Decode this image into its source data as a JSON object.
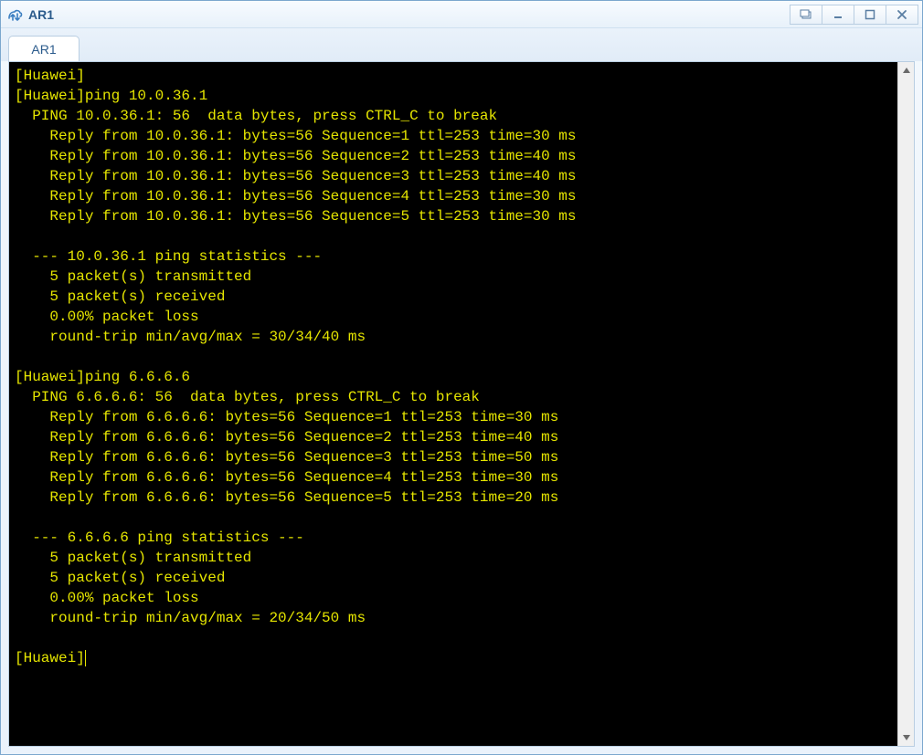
{
  "window": {
    "title": "AR1"
  },
  "tabs": [
    {
      "label": "AR1",
      "active": true
    }
  ],
  "terminal": {
    "prompt_start": "[Huawei]",
    "ping1": {
      "cmd": "[Huawei]ping 10.0.36.1",
      "header": "  PING 10.0.36.1: 56  data bytes, press CTRL_C to break",
      "replies": [
        "    Reply from 10.0.36.1: bytes=56 Sequence=1 ttl=253 time=30 ms",
        "    Reply from 10.0.36.1: bytes=56 Sequence=2 ttl=253 time=40 ms",
        "    Reply from 10.0.36.1: bytes=56 Sequence=3 ttl=253 time=40 ms",
        "    Reply from 10.0.36.1: bytes=56 Sequence=4 ttl=253 time=30 ms",
        "    Reply from 10.0.36.1: bytes=56 Sequence=5 ttl=253 time=30 ms"
      ],
      "stats_header": "  --- 10.0.36.1 ping statistics ---",
      "stats": [
        "    5 packet(s) transmitted",
        "    5 packet(s) received",
        "    0.00% packet loss",
        "    round-trip min/avg/max = 30/34/40 ms"
      ]
    },
    "ping2": {
      "cmd": "[Huawei]ping 6.6.6.6",
      "header": "  PING 6.6.6.6: 56  data bytes, press CTRL_C to break",
      "replies": [
        "    Reply from 6.6.6.6: bytes=56 Sequence=1 ttl=253 time=30 ms",
        "    Reply from 6.6.6.6: bytes=56 Sequence=2 ttl=253 time=40 ms",
        "    Reply from 6.6.6.6: bytes=56 Sequence=3 ttl=253 time=50 ms",
        "    Reply from 6.6.6.6: bytes=56 Sequence=4 ttl=253 time=30 ms",
        "    Reply from 6.6.6.6: bytes=56 Sequence=5 ttl=253 time=20 ms"
      ],
      "stats_header": "  --- 6.6.6.6 ping statistics ---",
      "stats": [
        "    5 packet(s) transmitted",
        "    5 packet(s) received",
        "    0.00% packet loss",
        "    round-trip min/avg/max = 20/34/50 ms"
      ]
    },
    "prompt_end": "[Huawei]"
  }
}
